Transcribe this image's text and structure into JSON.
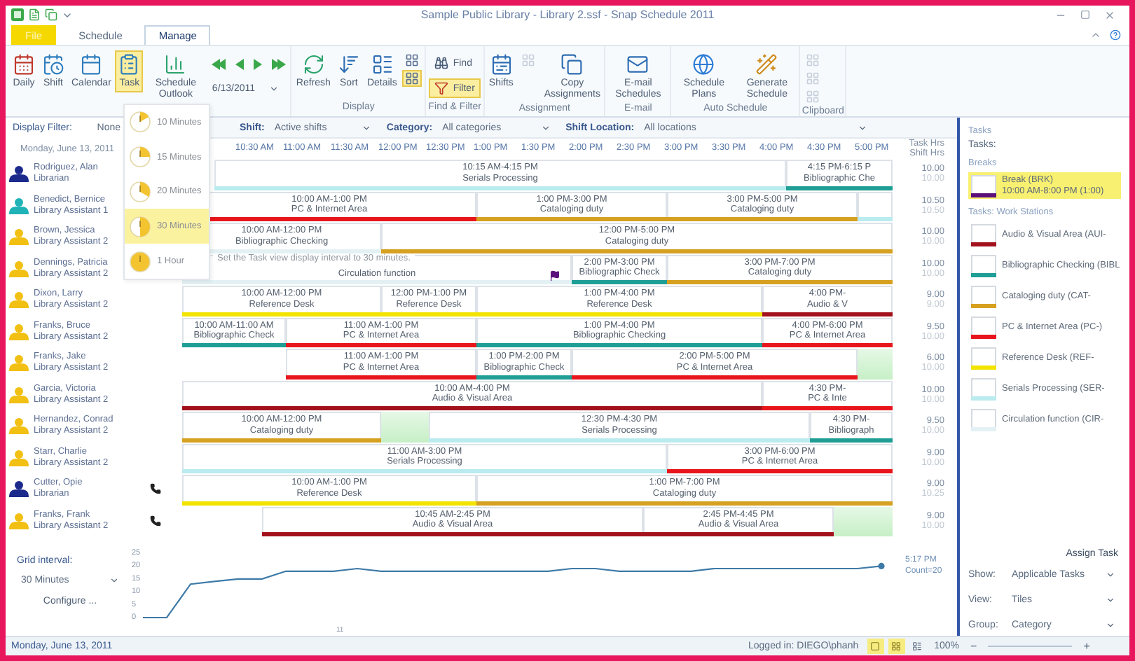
{
  "window": {
    "title": "Sample Public Library - Library 2.ssf - Snap Schedule 2011"
  },
  "tabs": [
    {
      "label": "File",
      "selected": false
    },
    {
      "label": "Schedule",
      "selected": false
    },
    {
      "label": "Manage",
      "selected": true
    }
  ],
  "ribbon": [
    {
      "items": [
        {
          "kind": "large",
          "label": "Daily",
          "selected": false
        },
        {
          "kind": "large",
          "label": "Shift",
          "selected": false
        },
        {
          "kind": "large",
          "label": "Calendar",
          "selected": false
        },
        {
          "kind": "large",
          "label": "Task",
          "selected": true
        },
        {
          "kind": "large",
          "label": "Schedule Outlook",
          "selected": false
        },
        {
          "kind": "nav"
        },
        {
          "kind": "date",
          "value": "6/13/2011"
        }
      ]
    },
    {
      "label": "Display",
      "items": [
        {
          "kind": "large",
          "label": "Refresh",
          "selected": false
        },
        {
          "kind": "large",
          "label": "Sort",
          "selected": false
        },
        {
          "kind": "large",
          "label": "Details",
          "selected": false
        },
        {
          "kind": "icons",
          "buttons": [
            {
              "selected": false,
              "disabled": false
            },
            {
              "selected": true,
              "disabled": false
            }
          ]
        }
      ]
    },
    {
      "label": "Find & Filter",
      "items": [
        {
          "kind": "small",
          "label": "Find",
          "selected": false
        },
        {
          "kind": "small",
          "label": "Filter",
          "selected": true
        }
      ]
    },
    {
      "label": "Assignment",
      "items": [
        {
          "kind": "large",
          "label": "Shifts",
          "selected": false
        },
        {
          "kind": "icons",
          "buttons": [
            {
              "selected": false,
              "disabled": true
            }
          ]
        },
        {
          "kind": "large",
          "label": "Copy Assignments",
          "selected": false
        }
      ]
    },
    {
      "label": "E-mail",
      "items": [
        {
          "kind": "large",
          "label": "E-mail Schedules",
          "selected": false
        }
      ]
    },
    {
      "label": "Auto Schedule",
      "items": [
        {
          "kind": "large",
          "label": "Schedule Plans",
          "selected": false
        },
        {
          "kind": "large",
          "label": "Generate Schedule",
          "selected": false
        }
      ]
    },
    {
      "label": "Clipboard",
      "items": [
        {
          "kind": "icons",
          "buttons": [
            {
              "selected": false,
              "disabled": true
            },
            {
              "selected": false,
              "disabled": true
            },
            {
              "selected": false,
              "disabled": true
            }
          ]
        }
      ]
    }
  ],
  "display_filter": {
    "label": "Display Filter:",
    "value": "None"
  },
  "date": "Monday, June 13, 2011",
  "filters": [
    {
      "label": "Shift:",
      "value": "Active shifts"
    },
    {
      "label": "Category:",
      "value": "All categories"
    },
    {
      "label": "Shift Location:",
      "value": "All locations"
    }
  ],
  "time_header": [
    "10:30 AM",
    "11:00 AM",
    "11:30 AM",
    "12:00 PM",
    "12:30 PM",
    "1:00 PM",
    "1:30 PM",
    "2:00 PM",
    "2:30 PM",
    "3:00 PM",
    "3:30 PM",
    "4:00 PM",
    "4:30 PM",
    "5:00 PM"
  ],
  "hours_header": [
    "Task Hrs",
    "Shift Hrs"
  ],
  "employees": [
    {
      "name": "Rodriguez, Alan",
      "role": "Librarian",
      "color": "#1c2a8c",
      "phone": false,
      "break_flag": false,
      "hours": [
        "10.00",
        "10.00"
      ],
      "shifts": [
        {
          "kind": "shift",
          "time": "10:15 AM-4:15 PM",
          "task": "Serials Processing",
          "color": "#b9ebef"
        },
        {
          "kind": "shift",
          "time": "4:15 PM-6:15 P",
          "task": "Bibliographic Che",
          "color": "#1f9e96"
        }
      ]
    },
    {
      "name": "Benedict, Bernice",
      "role": "Library Assistant 1",
      "color": "#1fb3b8",
      "phone": false,
      "break_flag": false,
      "hours": [
        "10.50",
        "10.50"
      ],
      "shifts": [
        {
          "kind": "shift",
          "time": "10:00 AM-1:00 PM",
          "task": "PC & Internet Area",
          "color": "#e8161c"
        },
        {
          "kind": "shift",
          "time": "1:00 PM-3:00 PM",
          "task": "Cataloging duty",
          "color": "#d6a021"
        },
        {
          "kind": "shift",
          "time": "3:00 PM-5:00 PM",
          "task": "Cataloging duty",
          "color": "#d6a021"
        },
        {
          "kind": "shift",
          "color": "#b9ebef"
        }
      ]
    },
    {
      "name": "Brown, Jessica",
      "role": "Library Assistant 2",
      "color": "#f2c012",
      "phone": false,
      "break_flag": false,
      "hours": [
        "10.00",
        "10.00"
      ],
      "shifts": [
        {
          "kind": "shift",
          "time": "10:00 AM-12:00 PM",
          "task": "Bibliographic Checking",
          "color": "#e3f1f4"
        },
        {
          "kind": "shift",
          "time": "12:00 PM-5:00 PM",
          "task": "Cataloging duty",
          "color": "#d6a021"
        }
      ]
    },
    {
      "name": "Dennings, Patricia",
      "role": "Library Assistant 2",
      "color": "#f2c012",
      "phone": false,
      "break_flag": true,
      "hours": [
        "10.00",
        "10.00"
      ],
      "shifts": [
        {
          "kind": "shift",
          "task": "Circulation function",
          "color": "#e3f1f4"
        },
        {
          "kind": "shift",
          "time": "2:00 PM-3:00 PM",
          "task": "Bibliographic Check",
          "color": "#1f9e96"
        },
        {
          "kind": "shift",
          "time": "3:00 PM-7:00 PM",
          "task": "Cataloging duty",
          "color": "#d6a021"
        }
      ]
    },
    {
      "name": "Dixon, Larry",
      "role": "Library Assistant 2",
      "color": "#f2c012",
      "phone": false,
      "break_flag": false,
      "hours": [
        "9.00",
        "9.00"
      ],
      "shifts": [
        {
          "kind": "shift",
          "time": "10:00 AM-12:00 PM",
          "task": "Reference Desk",
          "color": "#f2e400"
        },
        {
          "kind": "shift",
          "time": "12:00 PM-1:00 PM",
          "task": "Reference Desk",
          "color": "#f2e400"
        },
        {
          "kind": "shift",
          "time": "1:00 PM-4:00 PM",
          "task": "Reference Desk",
          "color": "#f2e400"
        },
        {
          "kind": "shift",
          "time": "4:00 PM-",
          "task": "Audio & V",
          "color": "#a3121c"
        }
      ]
    },
    {
      "name": "Franks, Bruce",
      "role": "Library Assistant 2",
      "color": "#f2c012",
      "phone": false,
      "break_flag": false,
      "hours": [
        "9.50",
        "10.00"
      ],
      "shifts": [
        {
          "kind": "shift",
          "time": "10:00 AM-11:00 AM",
          "task": "Bibliographic Check",
          "color": "#1f9e96"
        },
        {
          "kind": "shift",
          "time": "11:00 AM-1:00 PM",
          "task": "PC & Internet Area",
          "color": "#e8161c"
        },
        {
          "kind": "shift",
          "time": "1:00 PM-4:00 PM",
          "task": "Bibliographic Checking",
          "color": "#1f9e96"
        },
        {
          "kind": "shift",
          "time": "4:00 PM-6:00 PM",
          "task": "PC & Internet Area",
          "color": "#e8161c"
        }
      ]
    },
    {
      "name": "Franks, Jake",
      "role": "Library Assistant 2",
      "color": "#f2c012",
      "phone": false,
      "break_flag": false,
      "hours": [
        "6.00",
        "10.00"
      ],
      "shifts": [
        {
          "kind": "shift",
          "time": "11:00 AM-1:00 PM",
          "task": "PC & Internet Area",
          "color": "#e8161c"
        },
        {
          "kind": "shift",
          "time": "1:00 PM-2:00 PM",
          "task": "Bibliographic Check",
          "color": "#1f9e96"
        },
        {
          "kind": "shift",
          "time": "2:00 PM-5:00 PM",
          "task": "PC & Internet Area",
          "color": "#e8161c"
        },
        {
          "kind": "open"
        }
      ]
    },
    {
      "name": "Garcia, Victoria",
      "role": "Library Assistant 2",
      "color": "#f2c012",
      "phone": false,
      "break_flag": false,
      "hours": [
        "10.00",
        "10.00"
      ],
      "shifts": [
        {
          "kind": "shift",
          "time": "10:00 AM-4:00 PM",
          "task": "Audio & Visual Area",
          "color": "#a3121c"
        },
        {
          "kind": "shift",
          "time": "4:30 PM-",
          "task": "PC & Inte",
          "color": "#e8161c"
        }
      ]
    },
    {
      "name": "Hernandez, Conrad",
      "role": "Library Assistant 2",
      "color": "#f2c012",
      "phone": false,
      "break_flag": false,
      "hours": [
        "9.50",
        "10.00"
      ],
      "shifts": [
        {
          "kind": "shift",
          "time": "10:00 AM-12:00 PM",
          "task": "Cataloging duty",
          "color": "#d6a021"
        },
        {
          "kind": "open"
        },
        {
          "kind": "shift",
          "time": "12:30 PM-4:30 PM",
          "task": "Serials Processing",
          "color": "#b9ebef"
        },
        {
          "kind": "shift",
          "time": "4:30 PM-",
          "task": "Bibliograph",
          "color": "#1f9e96"
        }
      ]
    },
    {
      "name": "Starr, Charlie",
      "role": "Library Assistant 2",
      "color": "#f2c012",
      "phone": false,
      "break_flag": false,
      "hours": [
        "9.00",
        "10.00"
      ],
      "shifts": [
        {
          "kind": "shift",
          "time": "11:00 AM-3:00 PM",
          "task": "Serials Processing",
          "color": "#b9ebef"
        },
        {
          "kind": "shift",
          "time": "3:00 PM-6:00 PM",
          "task": "PC & Internet Area",
          "color": "#e8161c"
        }
      ]
    },
    {
      "name": "Cutter, Opie",
      "role": "Librarian",
      "color": "#1c2a8c",
      "phone": true,
      "break_flag": false,
      "hours": [
        "9.00",
        "10.25"
      ],
      "shifts": [
        {
          "kind": "shift",
          "time": "10:00 AM-1:00 PM",
          "task": "Reference Desk",
          "color": "#f2e400"
        },
        {
          "kind": "shift",
          "time": "1:00 PM-7:00 PM",
          "task": "Cataloging duty",
          "color": "#d6a021"
        }
      ]
    },
    {
      "name": "Franks, Frank",
      "role": "Library Assistant 2",
      "color": "#f2c012",
      "phone": true,
      "break_flag": false,
      "hours": [
        "9.00",
        "10.00"
      ],
      "shifts": [
        {
          "kind": "shift",
          "time": "10:45 AM-2:45 PM",
          "task": "Audio & Visual Area",
          "color": "#a3121c"
        },
        {
          "kind": "shift",
          "time": "2:45 PM-4:45 PM",
          "task": "Audio & Visual Area",
          "color": "#a3121c"
        },
        {
          "kind": "open"
        }
      ]
    }
  ],
  "staffing_chart": {
    "chart_data": {
      "type": "line",
      "ylim": [
        0,
        25
      ],
      "yticks": [
        {
          "value": 0,
          "label": "0"
        },
        {
          "value": 5,
          "label": "5"
        },
        {
          "value": 10,
          "label": "10"
        },
        {
          "value": 15,
          "label": "15"
        },
        {
          "value": 20,
          "label": "20"
        },
        {
          "value": 25,
          "label": "25"
        }
      ],
      "series": [
        {
          "color": "#3d7aa8",
          "values": [
            0,
            0,
            13,
            14,
            15,
            15,
            18,
            18,
            18,
            19,
            18,
            18,
            18,
            18,
            18,
            18,
            18,
            18,
            19,
            19,
            18,
            18,
            18,
            18,
            19,
            19,
            19,
            19,
            19,
            19,
            19,
            20
          ]
        }
      ],
      "annotations": [
        "5:17 PM",
        "Count=20",
        "11"
      ]
    }
  },
  "grid_interval": {
    "label": "Grid interval:",
    "value": "30 Minutes"
  },
  "configure": "Configure ...",
  "interval_menu": {
    "items": [
      {
        "label": "10 Minutes",
        "selected": false
      },
      {
        "label": "15 Minutes",
        "selected": false
      },
      {
        "label": "20 Minutes",
        "selected": false
      },
      {
        "label": "30 Minutes",
        "selected": true
      },
      {
        "label": "1 Hour",
        "selected": false
      }
    ],
    "tooltip": "Set the Task view display interval to 30 minutes."
  },
  "tasks_panel": {
    "title": "Tasks",
    "label": "Tasks:",
    "groups": [
      {
        "label": "Breaks",
        "items": [
          {
            "name": "Break (BRK)",
            "detail": "10:00 AM-8:00 PM (1:00)",
            "color": "#5b0f7a",
            "selected": true
          }
        ]
      },
      {
        "label": "Tasks: Work Stations",
        "items": [
          {
            "name": "Audio & Visual Area (AUI-",
            "color": "#a3121c",
            "selected": false
          },
          {
            "name": "Bibliographic Checking (BIBL",
            "color": "#1f9e96",
            "selected": false
          },
          {
            "name": "Cataloging duty (CAT-",
            "color": "#d6a021",
            "selected": false
          },
          {
            "name": "PC & Internet Area (PC-)",
            "color": "#e8161c",
            "selected": false
          },
          {
            "name": "Reference Desk (REF-",
            "color": "#f2e400",
            "selected": false
          },
          {
            "name": "Serials Processing (SER-",
            "color": "#b9ebef",
            "selected": false
          },
          {
            "name": "Circulation function (CIR-",
            "color": "#e3f1f4",
            "selected": false
          }
        ]
      }
    ],
    "assign": "Assign Task",
    "options": [
      {
        "label": "Show:",
        "value": "Applicable Tasks"
      },
      {
        "label": "View:",
        "value": "Tiles"
      },
      {
        "label": "Group:",
        "value": "Category"
      }
    ]
  },
  "status_bar": {
    "date": "Monday, June 13, 2011",
    "user": "Logged in: DIEGO\\phanh",
    "zoom": "100%",
    "zoom_out": "−",
    "zoom_in": "+"
  }
}
